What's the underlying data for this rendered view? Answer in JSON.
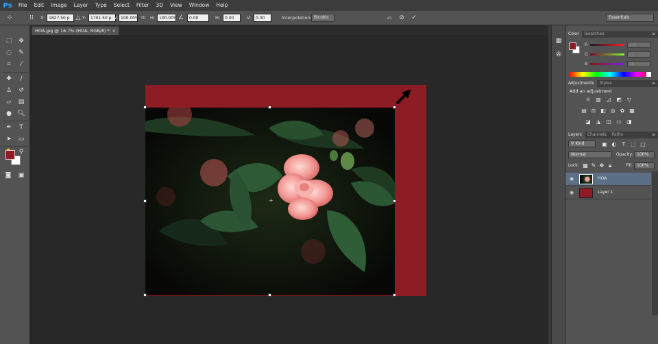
{
  "app": {
    "logo": "Ps"
  },
  "menu": [
    "File",
    "Edit",
    "Image",
    "Layer",
    "Type",
    "Select",
    "Filter",
    "3D",
    "View",
    "Window",
    "Help"
  ],
  "options": {
    "x_label": "X:",
    "x_value": "1827.50 p",
    "y_label": "Y:",
    "y_value": "1701.50 p",
    "w_label": "W:",
    "w_value": "100.00%",
    "h_label": "H:",
    "h_value": "100.00%",
    "angle_value": "0.00",
    "hskew_label": "H:",
    "hskew_value": "0.00",
    "vskew_label": "V:",
    "vskew_value": "0.00",
    "interp_label": "Interpolation:",
    "interp_value": "Bicubic",
    "workspace": "Essentials"
  },
  "document_tab": {
    "title": "HOA.jpg @ 16.7% (HOA, RGB/8) *",
    "close": "×"
  },
  "panels": {
    "color": {
      "tabs": [
        "Color",
        "Swatches"
      ],
      "channels": [
        {
          "label": "R",
          "value": "128"
        },
        {
          "label": "G",
          "value": "27"
        },
        {
          "label": "B",
          "value": "36"
        }
      ]
    },
    "adjustments": {
      "tabs": [
        "Adjustments",
        "Styles"
      ],
      "heading": "Add an adjustment"
    },
    "layers": {
      "tabs": [
        "Layers",
        "Channels",
        "Paths"
      ],
      "kind": "Kind",
      "blend": "Normal",
      "opacity_label": "Opacity:",
      "opacity_value": "100%",
      "lock_label": "Lock:",
      "fill_label": "Fill:",
      "fill_value": "100%",
      "items": [
        {
          "name": "HOA"
        },
        {
          "name": "Layer 1"
        }
      ]
    }
  },
  "colors": {
    "foreground": "#8e1c24",
    "background": "#ffffff",
    "layer_fill": "#8e1c24"
  }
}
